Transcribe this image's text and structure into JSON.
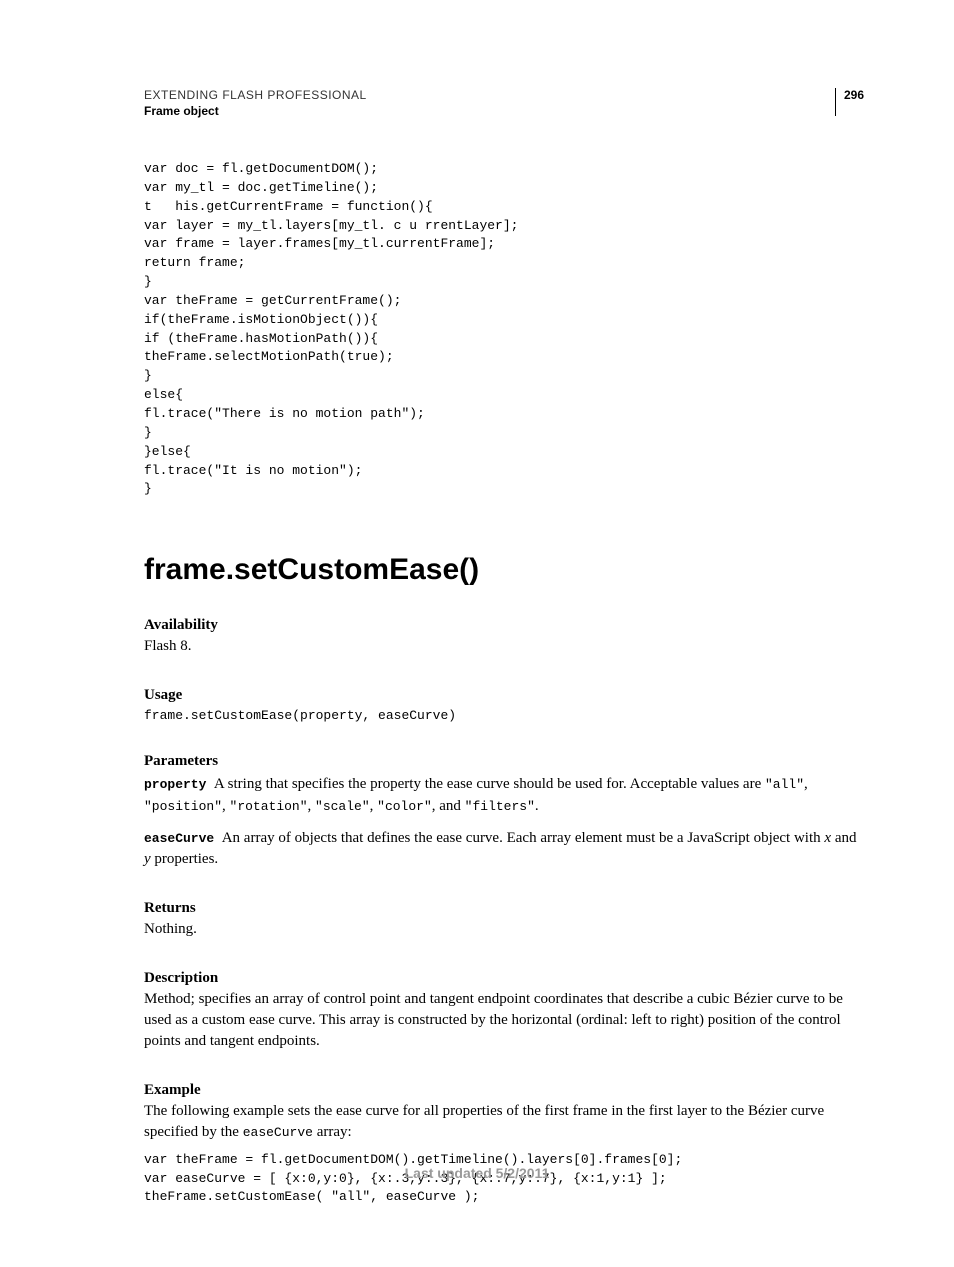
{
  "header": {
    "title": "EXTENDING FLASH PROFESSIONAL",
    "section": "Frame object",
    "page_number": "296"
  },
  "code_block_1": "var doc = fl.getDocumentDOM(); \nvar my_tl = doc.getTimeline(); \nt   his.getCurrentFrame = function(){ \nvar layer = my_tl.layers[my_tl. c u rrentLayer]; \nvar frame = layer.frames[my_tl.currentFrame]; \nreturn frame; \n} \nvar theFrame = getCurrentFrame(); \nif(theFrame.isMotionObject()){ \nif (theFrame.hasMotionPath()){ \ntheFrame.selectMotionPath(true); \n} \nelse{ \nfl.trace(\"There is no motion path\"); \n} \n}else{ \nfl.trace(\"It is no motion\"); \n}",
  "heading": "frame.setCustomEase()",
  "availability": {
    "label": "Availability",
    "text": "Flash 8."
  },
  "usage": {
    "label": "Usage",
    "code": "frame.setCustomEase(property, easeCurve)"
  },
  "parameters": {
    "label": "Parameters",
    "p1_name": "property",
    "p1_pre": "A string that specifies the property the ease curve should be used for. Acceptable values are ",
    "p1_vals": [
      "\"all\"",
      "\"position\"",
      "\"rotation\"",
      "\"scale\"",
      "\"color\"",
      "\"filters\""
    ],
    "p1_and": ", and ",
    "p2_name": "easeCurve",
    "p2_pre": "An array of objects that defines the ease curve. Each array element must be a JavaScript object with ",
    "p2_x": "x",
    "p2_mid": " and ",
    "p2_y": "y",
    "p2_post": " properties."
  },
  "returns": {
    "label": "Returns",
    "text": "Nothing."
  },
  "description": {
    "label": "Description",
    "text": "Method; specifies an array of control point and tangent endpoint coordinates that describe a cubic Bézier curve to be used as a custom ease curve. This array is constructed by the horizontal (ordinal: left to right) position of the control points and tangent endpoints."
  },
  "example": {
    "label": "Example",
    "text_pre": "The following example sets the ease curve for all properties of the first frame in the first layer to the Bézier curve specified by the ",
    "text_code": "easeCurve",
    "text_post": " array:",
    "code": "var theFrame = fl.getDocumentDOM().getTimeline().layers[0].frames[0]; \nvar easeCurve = [ {x:0,y:0}, {x:.3,y:.3}, {x:.7,y:.7}, {x:1,y:1} ]; \ntheFrame.setCustomEase( \"all\", easeCurve );"
  },
  "footer": "Last updated 5/2/2011"
}
